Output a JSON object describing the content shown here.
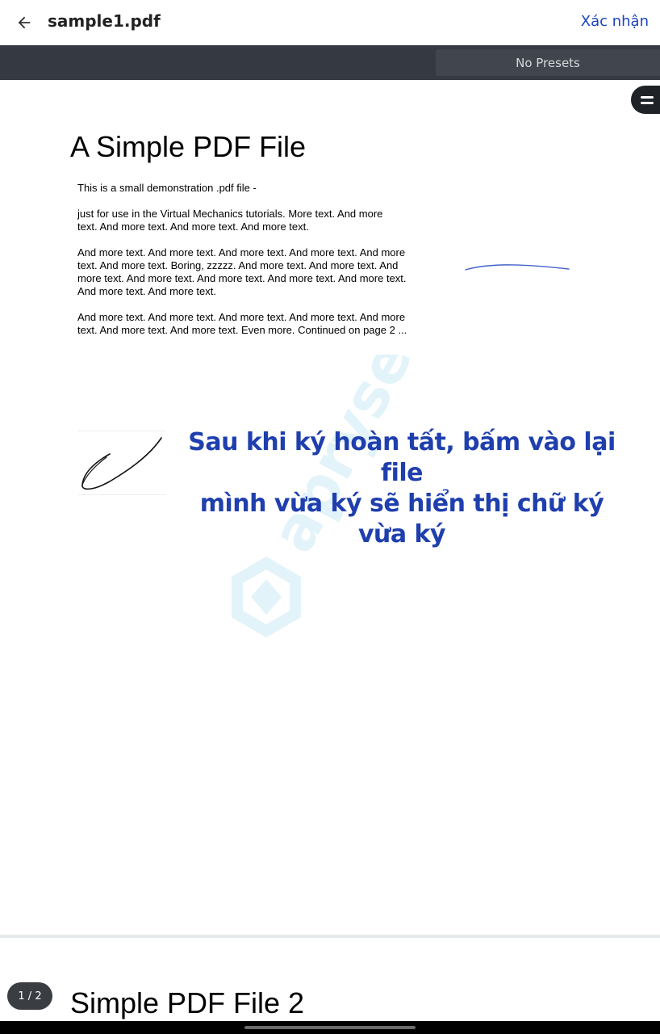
{
  "header": {
    "file_name": "sample1.pdf",
    "confirm_label": "Xác nhận"
  },
  "toolbar": {
    "presets_label": "No Presets"
  },
  "page1": {
    "title": "A Simple PDF File",
    "paragraphs": [
      "This is a small demonstration .pdf file -",
      "just for use in the Virtual Mechanics tutorials. More text. And more\ntext. And more text. And more text. And more text.",
      "And more text. And more text. And more text. And more text. And more\ntext. And more text. Boring, zzzzz. And more text. And more text. And\nmore text. And more text. And more text. And more text. And more text.\nAnd more text. And more text.",
      "And more text. And more text. And more text. And more text. And more\ntext. And more text. And more text. Even more. Continued on page 2 ..."
    ],
    "watermark_text": "apryse",
    "caption_line1": "Sau khi ký hoàn tất, bấm vào lại file",
    "caption_line2": "mình vừa ký sẽ hiển thị chữ ký vừa ký"
  },
  "page2": {
    "title": "Simple PDF File 2"
  },
  "pagination": {
    "indicator": "1 / 2"
  },
  "colors": {
    "accent": "#1a45c2",
    "caption": "#1f3fae",
    "toolbar": "#353a42"
  }
}
